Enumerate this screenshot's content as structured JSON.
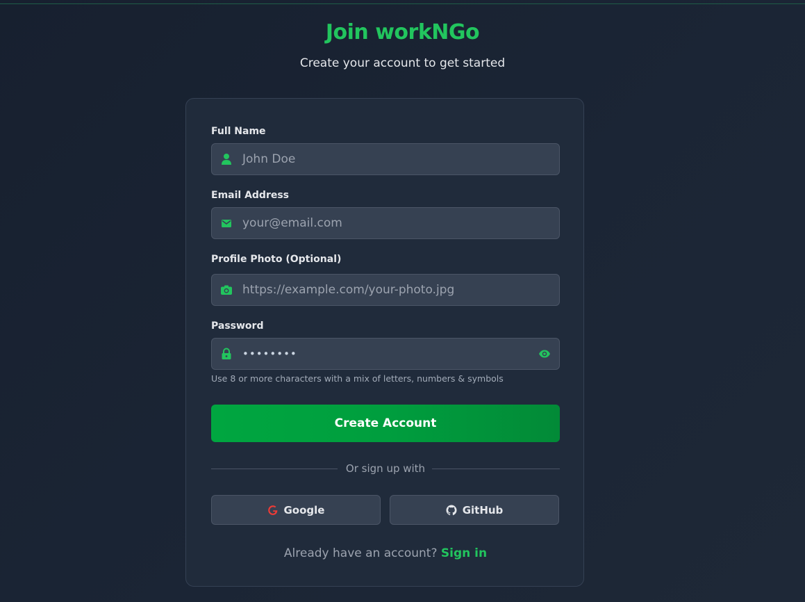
{
  "header": {
    "title": "Join workNGo",
    "subtitle": "Create your account to get started"
  },
  "form": {
    "full_name": {
      "label": "Full Name",
      "placeholder": "John Doe",
      "icon": "user-icon"
    },
    "email": {
      "label": "Email Address",
      "placeholder": "your@email.com",
      "icon": "mail-icon"
    },
    "photo": {
      "label": "Profile Photo (Optional)",
      "placeholder": "https://example.com/your-photo.jpg",
      "icon": "camera-icon"
    },
    "password": {
      "label": "Password",
      "value": "••••••••",
      "icon": "lock-icon",
      "toggle_icon": "eye-icon",
      "hint": "Use 8 or more characters with a mix of letters, numbers & symbols"
    },
    "submit_label": "Create Account"
  },
  "divider_text": "Or sign up with",
  "social": {
    "google_label": "Google",
    "github_label": "GitHub"
  },
  "signin": {
    "prompt": "Already have an account?",
    "link_label": "Sign in"
  },
  "colors": {
    "accent": "#22c55e",
    "button": "#00a640",
    "background": "#1b2535",
    "card": "#202b3b",
    "input": "#364152"
  }
}
